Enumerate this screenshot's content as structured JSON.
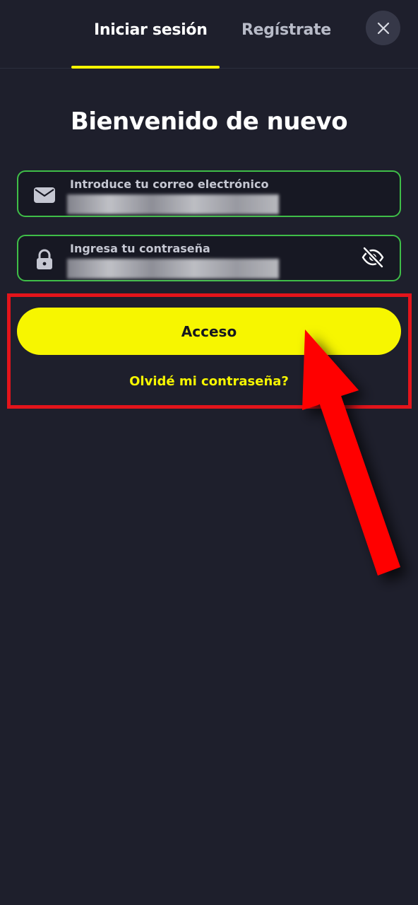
{
  "tabs": {
    "login": "Iniciar sesión",
    "register": "Regístrate"
  },
  "title": "Bienvenido de nuevo",
  "email_field": {
    "label": "Introduce tu correo electrónico",
    "icon": "envelope-icon"
  },
  "password_field": {
    "label": "Ingresa tu contraseña",
    "icon": "lock-icon",
    "toggle_icon": "eye-slash-icon"
  },
  "submit_label": "Acceso",
  "forgot_label": "Olvidé mi contraseña?",
  "colors": {
    "background": "#1e1f2c",
    "accent": "#f7f600",
    "field_border": "#3fbe48",
    "highlight": "#e3141b"
  }
}
